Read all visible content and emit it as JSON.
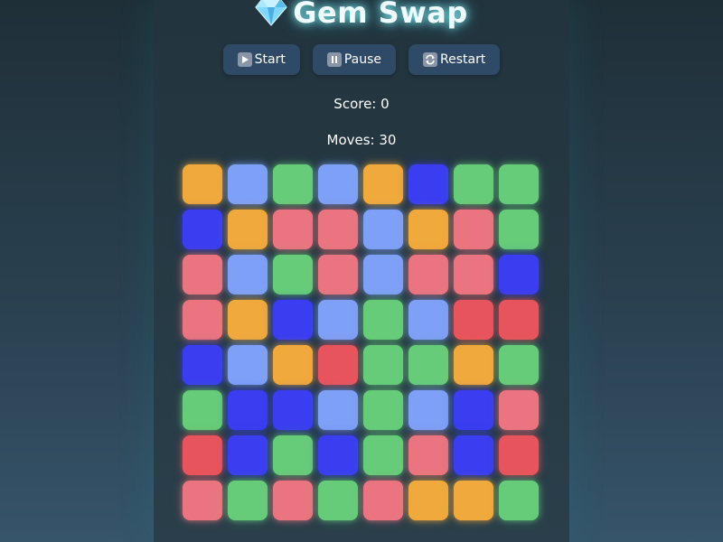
{
  "header": {
    "title": "Gem Swap",
    "icon": "gem-icon"
  },
  "controls": {
    "start_label": "Start",
    "pause_label": "Pause",
    "restart_label": "Restart",
    "start_icon": "play-icon",
    "pause_icon": "pause-icon",
    "restart_icon": "restart-icon"
  },
  "stats": {
    "score_text": "Score: 0",
    "moves_text": "Moves: 30"
  },
  "colors": {
    "O": "#f0a93c",
    "L": "#7ea0f6",
    "G": "#66cc7a",
    "B": "#3a3ef0",
    "P": "#ea7580",
    "R": "#e8545d"
  },
  "board": [
    [
      "O",
      "L",
      "G",
      "L",
      "O",
      "B",
      "G",
      "G"
    ],
    [
      "B",
      "O",
      "P",
      "P",
      "L",
      "O",
      "P",
      "G"
    ],
    [
      "P",
      "L",
      "G",
      "P",
      "L",
      "P",
      "P",
      "B"
    ],
    [
      "P",
      "O",
      "B",
      "L",
      "G",
      "L",
      "R",
      "R"
    ],
    [
      "B",
      "L",
      "O",
      "R",
      "G",
      "G",
      "O",
      "G"
    ],
    [
      "G",
      "B",
      "B",
      "L",
      "G",
      "L",
      "B",
      "P"
    ],
    [
      "R",
      "B",
      "G",
      "B",
      "G",
      "P",
      "B",
      "R"
    ],
    [
      "P",
      "G",
      "P",
      "G",
      "P",
      "O",
      "O",
      "G"
    ]
  ]
}
